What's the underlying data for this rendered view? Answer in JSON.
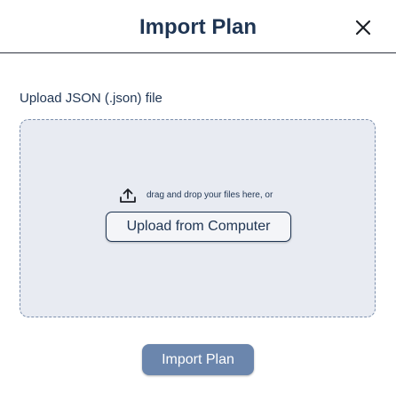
{
  "dialog": {
    "title": "Import Plan",
    "close_icon": "close-icon"
  },
  "upload": {
    "label": "Upload JSON (.json) file",
    "hint_icon": "upload-icon",
    "hint": "drag and drop your files here, or",
    "button_label": "Upload from Computer"
  },
  "actions": {
    "import_label": "Import Plan"
  },
  "colors": {
    "title_text": "#1f3553",
    "dropzone_bg": "#e8ebf2",
    "dropzone_border": "#7d90ad",
    "import_button_bg": "#6b86ad"
  }
}
